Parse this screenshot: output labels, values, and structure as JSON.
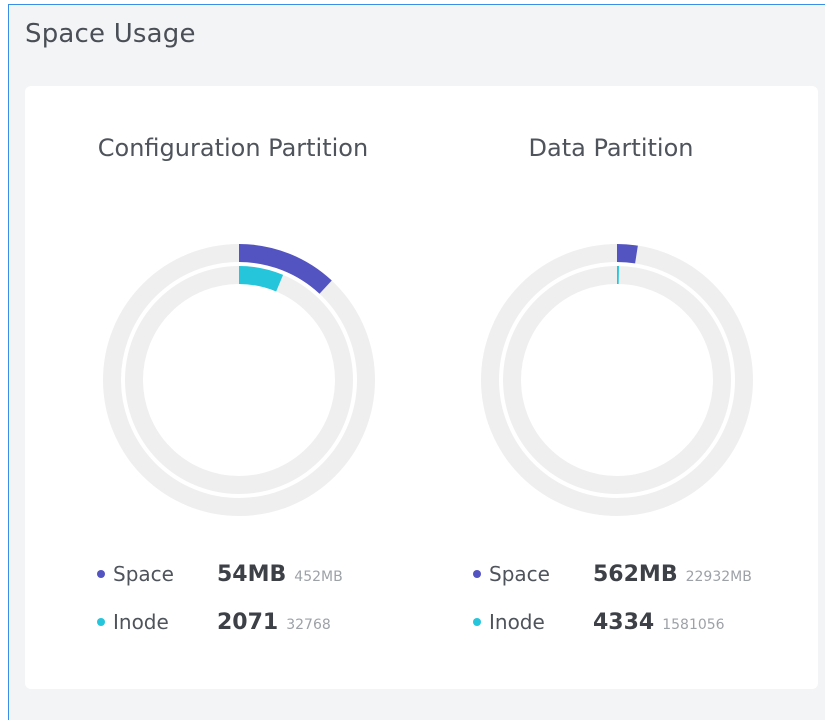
{
  "panel": {
    "title": "Space Usage"
  },
  "colors": {
    "space": "#5353c2",
    "inode": "#25c5dc",
    "track": "#efefef"
  },
  "chart_data": [
    {
      "type": "donut",
      "title": "Configuration Partition",
      "series": [
        {
          "name": "Space",
          "used": 54,
          "used_label": "54MB",
          "total": 452,
          "total_label": "452MB"
        },
        {
          "name": "Inode",
          "used": 2071,
          "used_label": "2071",
          "total": 32768,
          "total_label": "32768"
        }
      ]
    },
    {
      "type": "donut",
      "title": "Data Partition",
      "series": [
        {
          "name": "Space",
          "used": 562,
          "used_label": "562MB",
          "total": 22932,
          "total_label": "22932MB"
        },
        {
          "name": "Inode",
          "used": 4334,
          "used_label": "4334",
          "total": 1581056,
          "total_label": "1581056"
        }
      ]
    }
  ]
}
